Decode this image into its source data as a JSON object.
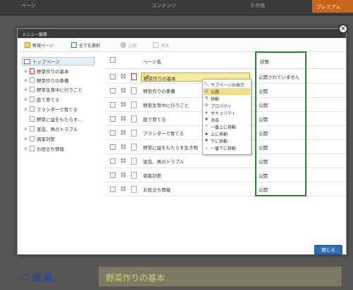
{
  "topbar": {
    "items": [
      "ページ",
      "コンテンツ",
      "その他"
    ],
    "orange_label": "プレミアム"
  },
  "background": {
    "kanji": "二 庭 菌",
    "banner": "野菜作りの基本"
  },
  "modal": {
    "title": "メニュー編集",
    "close_button": "閉じる"
  },
  "toolbar": {
    "new_page": "新規ページ",
    "select_all": "全てを選択",
    "publish": "公開",
    "delete": "消去"
  },
  "tree": {
    "top_page": "トップページ",
    "items": [
      "野菜作りの基本",
      "野菜作りの準備",
      "野菜生育中に行うこと",
      "庭で育てる",
      "プランターで育てる",
      "野菜に益をもたらす…",
      "害虫、鳥のトラブル",
      "病害対策",
      "お役立ち情報"
    ]
  },
  "grid": {
    "columns": {
      "page_name": "ページ名",
      "status": "状態"
    },
    "rows": [
      {
        "name": "野菜作りの基本",
        "status": "公開されていません"
      },
      {
        "name": "野菜作りの準備",
        "status": "公開"
      },
      {
        "name": "野菜生育中に行うこと",
        "status": "公開"
      },
      {
        "name": "庭で育てる",
        "status": "公開"
      },
      {
        "name": "プランターで育てる",
        "status": "公開"
      },
      {
        "name": "野菜に益をもたらす生き物",
        "status": "公開"
      },
      {
        "name": "害虫、鳥のトラブル",
        "status": "公開"
      },
      {
        "name": "病害対策",
        "status": "公開"
      },
      {
        "name": "お役立ち情報",
        "status": "公開"
      }
    ]
  },
  "context_menu": {
    "items": [
      "サブページの表示",
      "公開",
      "移動",
      "プロパティ",
      "セキュリティ",
      "消去",
      "一番上に移動",
      "上に移動",
      "下に移動",
      "一番下に移動"
    ]
  },
  "colors": {
    "highlight": "#f7eb9c",
    "green_box": "#2e7d32",
    "button": "#2f6db5"
  }
}
